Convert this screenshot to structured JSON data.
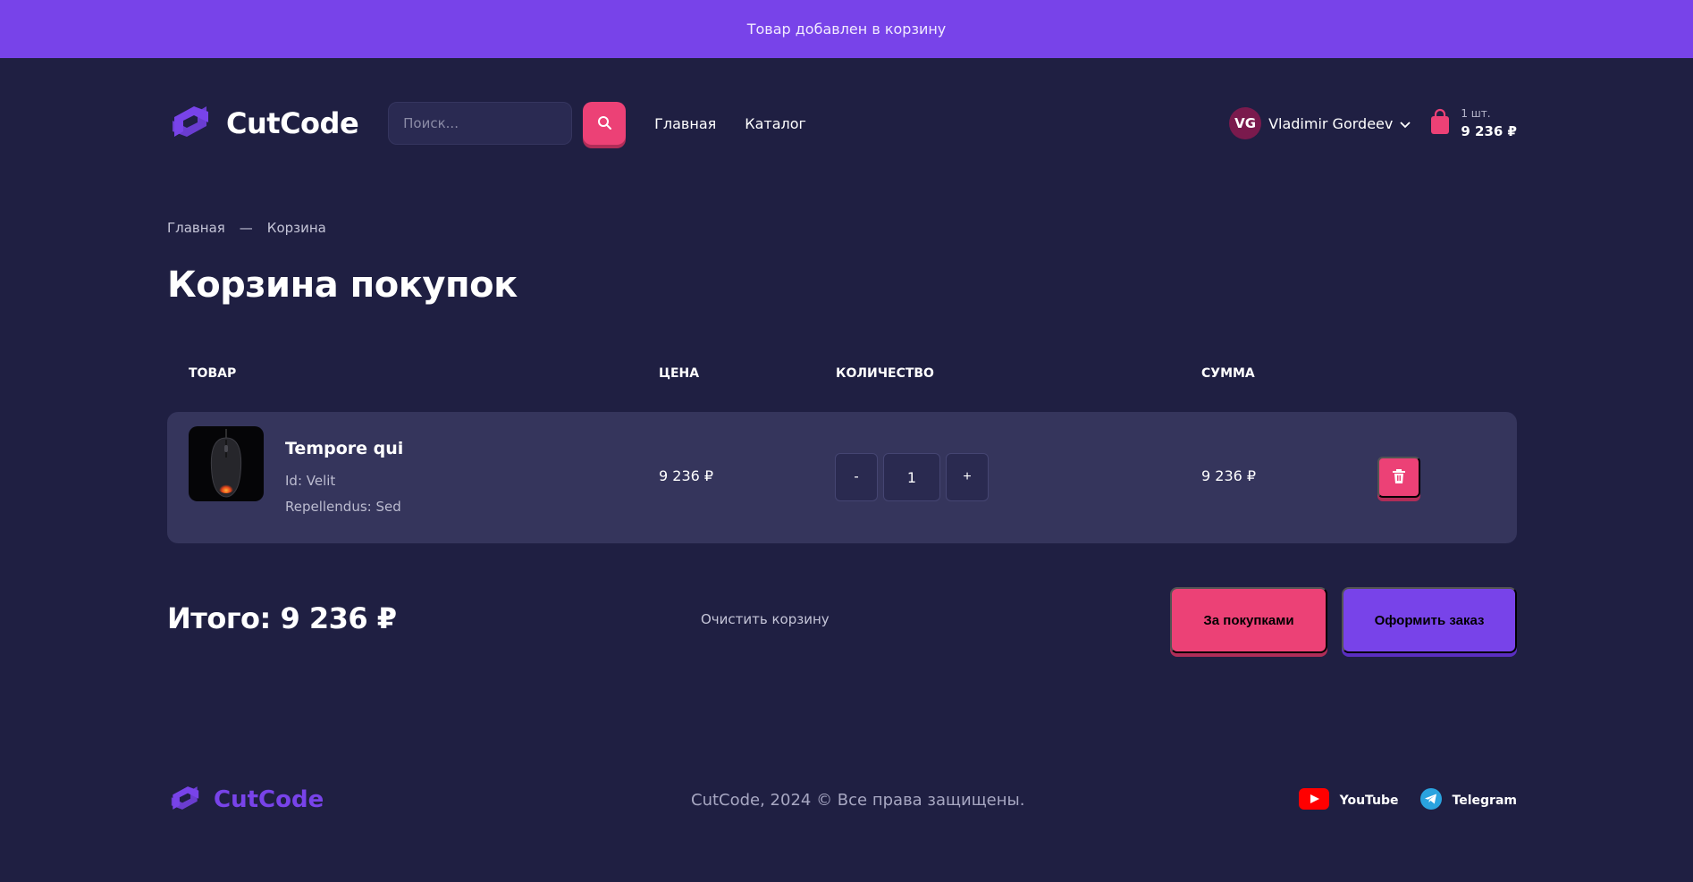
{
  "notification": "Товар добавлен в корзину",
  "header": {
    "logo_text": "CutCode",
    "search_placeholder": "Поиск...",
    "nav": [
      "Главная",
      "Каталог"
    ],
    "user": {
      "initials": "VG",
      "name": "Vladimir Gordeev"
    },
    "cart": {
      "count": "1 шт.",
      "sum": "9 236 ₽"
    }
  },
  "breadcrumb": {
    "home": "Главная",
    "separator": "—",
    "current": "Корзина"
  },
  "page_title": "Корзина покупок",
  "table": {
    "headers": {
      "product": "ТОВАР",
      "price": "ЦЕНА",
      "quantity": "КОЛИЧЕСТВО",
      "sum": "СУММА"
    },
    "items": [
      {
        "title": "Tempore qui",
        "attr1": "Id: Velit",
        "attr2": "Repellendus: Sed",
        "price": "9 236 ₽",
        "quantity": "1",
        "sum": "9 236 ₽"
      }
    ],
    "minus_label": "-",
    "plus_label": "+"
  },
  "summary": {
    "total": "Итого: 9 236 ₽",
    "clear_label": "Очистить корзину",
    "continue_label": "За покупками",
    "order_label": "Оформить заказ"
  },
  "footer": {
    "logo_text": "CutCode",
    "copyright": "CutCode, 2024 © Все права защищены.",
    "socials": [
      "YouTube",
      "Telegram"
    ]
  },
  "colors": {
    "accent_purple": "#7843e9",
    "accent_pink": "#ec4176",
    "background": "#1f1f42",
    "card": "#35355c"
  }
}
